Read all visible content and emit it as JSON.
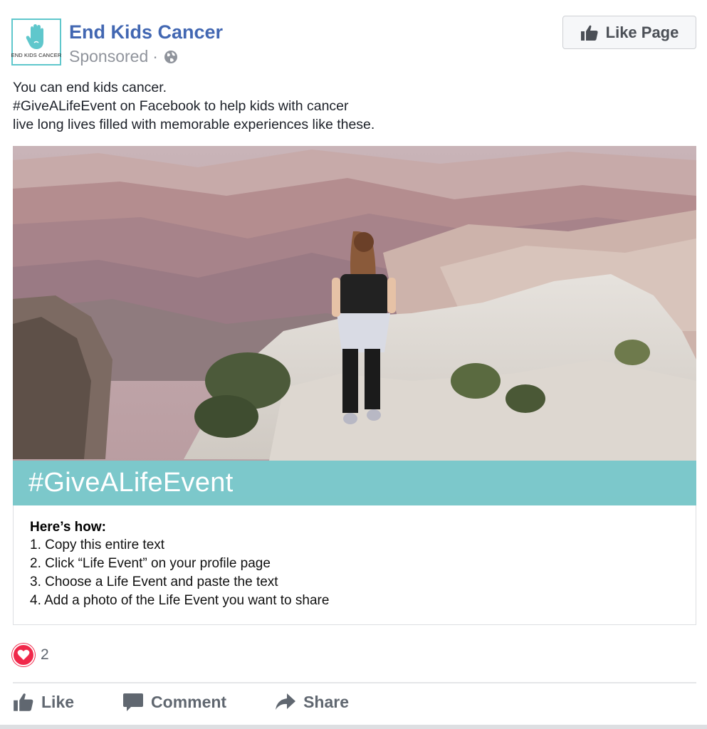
{
  "page": {
    "name": "End Kids Cancer",
    "avatar_text": "END KIDS CANCER",
    "sponsored": "Sponsored",
    "separator": "·",
    "privacy_icon": "globe-icon",
    "brand_color": "#4267b2",
    "accent_color": "#5fc7cc"
  },
  "like_page_button": {
    "label": "Like Page",
    "icon": "thumbs-up-icon"
  },
  "post": {
    "lines": [
      "You can end kids cancer.",
      "#GiveALifeEvent on Facebook to help kids with cancer",
      "live long lives filled with memorable experiences like these."
    ]
  },
  "image": {
    "hashtag": "#GiveALifeEvent",
    "band_color": "#76ccce"
  },
  "howto": {
    "title": "Here’s how:",
    "steps": [
      "1. Copy this entire text",
      "2. Click “Life Event” on your profile page",
      "3. Choose a Life Event and paste the text",
      "4. Add a photo of the Life Event you want to share"
    ]
  },
  "reactions": {
    "icon": "heart-icon",
    "count": "2",
    "color": "#f0284a"
  },
  "actions": {
    "like": "Like",
    "comment": "Comment",
    "share": "Share"
  }
}
